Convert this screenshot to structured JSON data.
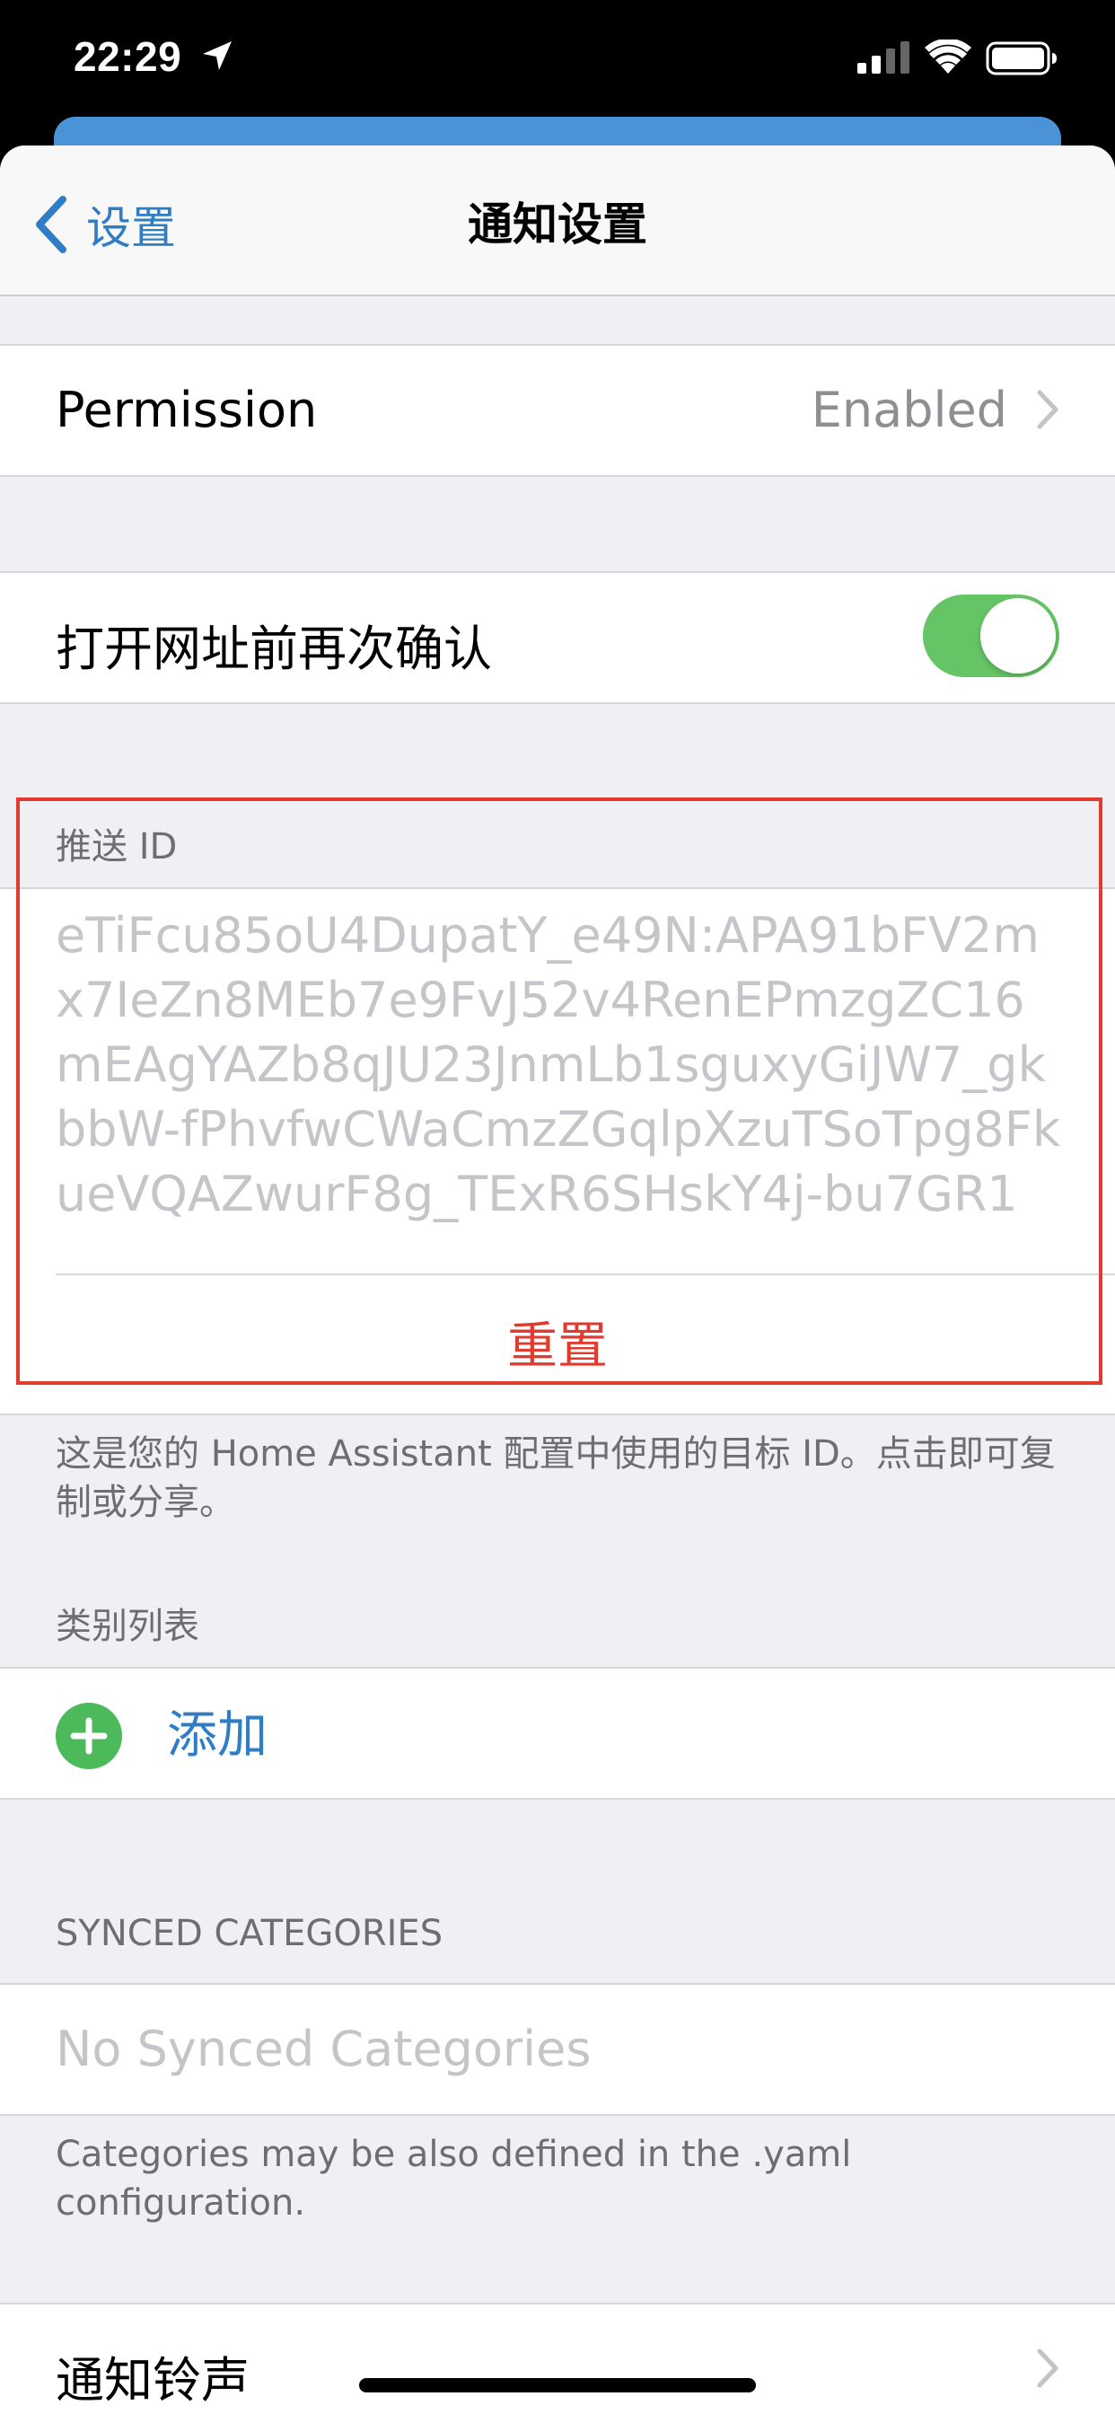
{
  "status_bar": {
    "time": "22:29"
  },
  "nav": {
    "back_label": "设置",
    "title": "通知设置"
  },
  "permission": {
    "label": "Permission",
    "value": "Enabled"
  },
  "confirm_url": {
    "label": "打开网址前再次确认",
    "enabled": true
  },
  "push_id_section": {
    "header": "推送 ID",
    "push_id": "eTiFcu85oU4DupatY_e49N:APA91bFV2mx7IeZn8MEb7e9FvJ52v4RenEPmzgZC16mEAgYAZb8qJU23JnmLb1sguxyGiJW7_gkbbW-fPhvfwCWaCmzZGqlpXzuTSoTpg8FkueVQAZwurF8g_TExR6SHskY4j-bu7GR1",
    "reset_label": "重置",
    "footer": "这是您的 Home Assistant 配置中使用的目标 ID。点击即可复制或分享。"
  },
  "categories": {
    "header": "类别列表",
    "add_label": "添加"
  },
  "synced_categories": {
    "header": "SYNCED CATEGORIES",
    "empty_label": "No Synced Categories",
    "footer": "Categories may be also defined in the .yaml configuration."
  },
  "sound": {
    "label": "通知铃声"
  },
  "colors": {
    "accent": "#2f7dc5",
    "destructive": "#e23a2e",
    "toggle_on": "#65c466",
    "add_icon": "#4cba5a"
  }
}
